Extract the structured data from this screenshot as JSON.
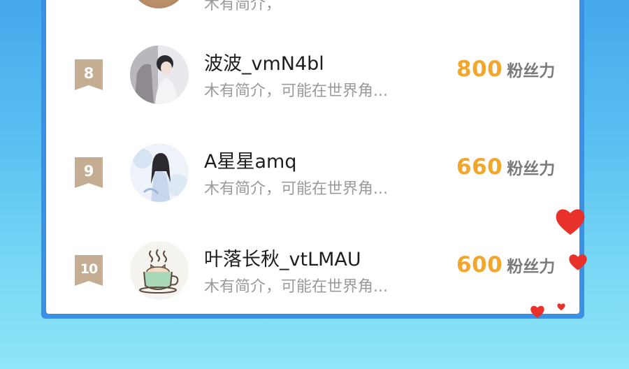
{
  "previous_row": {
    "desc": "木有简介，"
  },
  "ranking": [
    {
      "rank": "8",
      "avatar": "person-with-horse-photo",
      "name": "波波_vmN4bl",
      "desc": "木有简介，可能在世界角...",
      "score": "800",
      "unit": "粉丝力"
    },
    {
      "rank": "9",
      "avatar": "anime-girl-illustration",
      "name": "A星星amq",
      "desc": "木有简介，可能在世界角...",
      "score": "660",
      "unit": "粉丝力"
    },
    {
      "rank": "10",
      "avatar": "coffee-cup-cat-icon",
      "name": "叶落长秋_vtLMAU",
      "desc": "木有简介，可能在世界角...",
      "score": "600",
      "unit": "粉丝力"
    }
  ],
  "colors": {
    "background_top": "#45a8ec",
    "background_bottom": "#8ee6f7",
    "panel_border": "#3a90e4",
    "rank_badge": "#c4ad92",
    "score": "#f2a62b",
    "heart": "#e8312a"
  },
  "decorations": [
    "heart-icon",
    "heart-icon",
    "heart-icon",
    "heart-icon"
  ]
}
